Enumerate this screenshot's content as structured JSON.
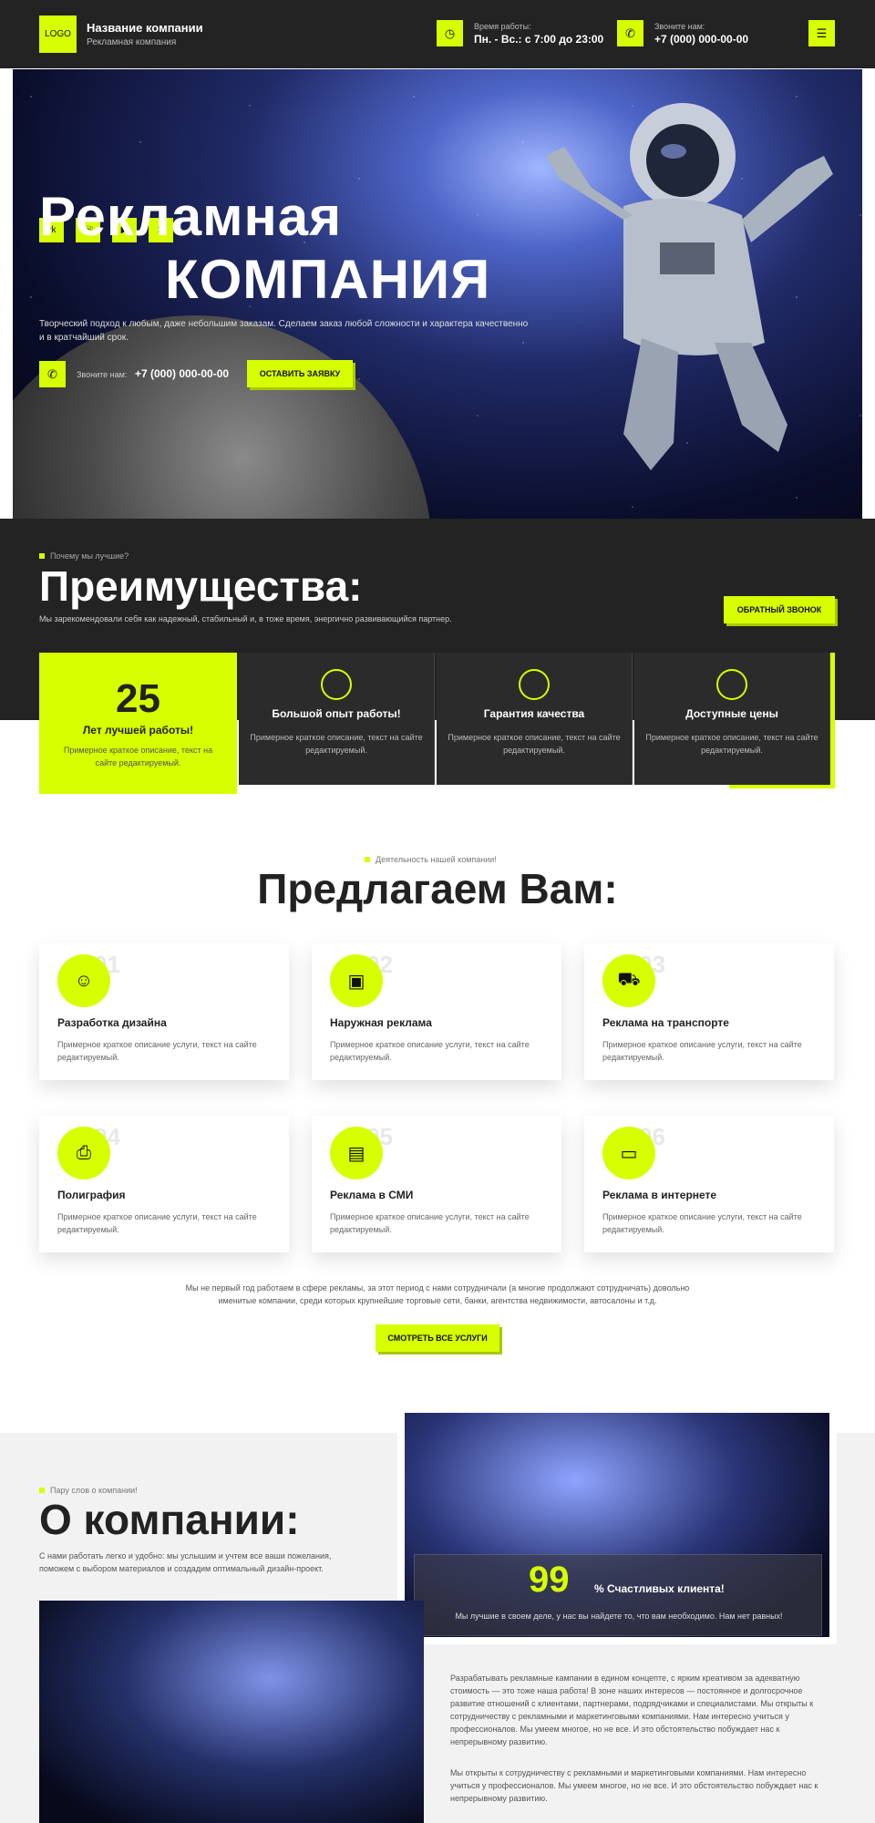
{
  "header": {
    "logo": "LOGO",
    "company_name": "Название компании",
    "company_sub": "Рекламная компания",
    "hours_label": "Время работы:",
    "hours_value": "Пн. - Вс.: с 7:00 до 23:00",
    "call_label": "Звоните нам:",
    "phone": "+7 (000) 000-00-00"
  },
  "hero": {
    "title_line1": "Рекламная",
    "title_line2": "КОМПАНИЯ",
    "desc": "Творческий подход к любым, даже небольшим заказам. Сделаем заказ любой сложности и характера качественно и в кратчайший срок.",
    "call_label": "Звоните нам:",
    "phone": "+7 (000) 000-00-00",
    "request_button": "ОСТАВИТЬ ЗАЯВКУ",
    "social": [
      "vk",
      "whatsapp",
      "youtube",
      "telegram"
    ]
  },
  "advantages": {
    "kicker": "Почему мы лучшие?",
    "title": "Преимущества:",
    "desc": "Мы зарекомендовали себя как надежный, стабильный и, в тоже время, энергично развивающийся партнер.",
    "callback_button": "ОБРАТНЫЙ ЗВОНОК",
    "cards": [
      {
        "big": "25",
        "title": "Лет лучшей работы!",
        "desc": "Примерное краткое описание, текст на сайте редактируемый."
      },
      {
        "title": "Большой опыт работы!",
        "desc": "Примерное краткое описание, текст на сайте редактируемый."
      },
      {
        "title": "Гарантия качества",
        "desc": "Примерное краткое описание, текст на сайте редактируемый."
      },
      {
        "title": "Доступные цены",
        "desc": "Примерное краткое описание, текст на сайте редактируемый."
      }
    ]
  },
  "services": {
    "kicker": "Деятельность нашей компании!",
    "title": "Предлагаем Вам:",
    "items": [
      {
        "num": "01",
        "title": "Разработка дизайна",
        "desc": "Примерное краткое описание услуги, текст на сайте редактируемый."
      },
      {
        "num": "02",
        "title": "Наружная реклама",
        "desc": "Примерное краткое описание услуги, текст на сайте редактируемый."
      },
      {
        "num": "03",
        "title": "Реклама на транспорте",
        "desc": "Примерное краткое описание услуги, текст на сайте редактируемый."
      },
      {
        "num": "04",
        "title": "Полиграфия",
        "desc": "Примерное краткое описание услуги, текст на сайте редактируемый."
      },
      {
        "num": "05",
        "title": "Реклама в СМИ",
        "desc": "Примерное краткое описание услуги, текст на сайте редактируемый."
      },
      {
        "num": "06",
        "title": "Реклама в интернете",
        "desc": "Примерное краткое описание услуги, текст на сайте редактируемый."
      }
    ],
    "note": "Мы не первый год работаем в сфере рекламы, за этот период с нами сотрудничали (а многие продолжают сотрудничать) довольно именитые компании, среди которых крупнейшие торговые сети, банки, агентства недвижимости, автосалоны и т.д.",
    "all_button": "СМОТРЕТЬ ВСЕ УСЛУГИ"
  },
  "about": {
    "kicker": "Пару слов о компании!",
    "title": "О компании:",
    "desc": "С нами работать легко и удобно: мы услышим и учтем все ваши пожелания, поможем с выбором материалов и создадим оптимальный дизайн-проект.",
    "stat_num": "99",
    "stat_label": "% Счастливых клиента!",
    "stat_desc": "Мы лучшие в своем деле, у нас вы найдете то, что вам необходимо. Нам нет равных!",
    "para1": "Разрабатывать рекламные кампании в едином концепте, с ярким креативом за адекватную стоимость — это тоже наша работа! В зоне наших интересов — постоянное и долгосрочное развитие отношений с клиентами, партнерами, подрядчиками и специалистами. Мы открыты к сотрудничеству с рекламными и маркетинговыми компаниями. Нам интересно учиться у профессионалов. Мы умеем многое, но не все. И это обстоятельство побуждает нас к непрерывному развитию.",
    "para2": "Мы открыты к сотрудничеству с рекламными и маркетинговыми компаниями. Нам интересно учиться у профессионалов. Мы умеем многое, но не все. И это обстоятельство побуждает нас к непрерывному развитию."
  }
}
